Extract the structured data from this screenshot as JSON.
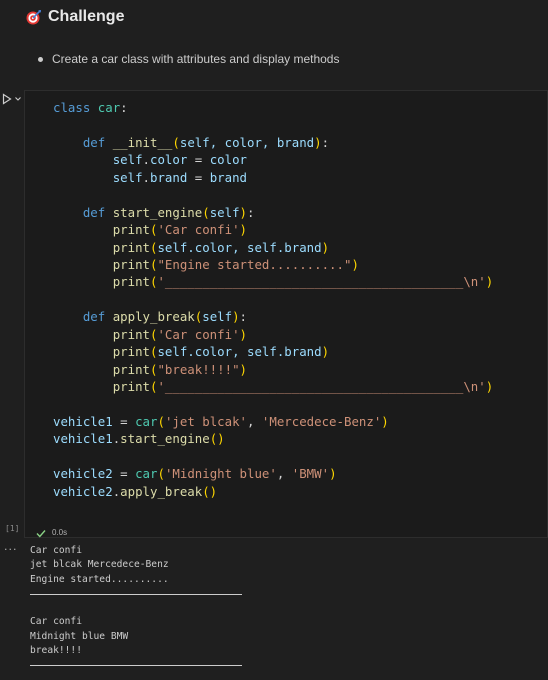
{
  "markdown": {
    "heading": "Challenge",
    "heading_icon": "dart-target-icon",
    "bullet": "Create a car class with attributes and display methods"
  },
  "cell": {
    "execution_count": "[1]",
    "status_time": "0.0s",
    "status_icon": "check-icon",
    "run_icon": "play-icon"
  },
  "code": {
    "l1_kw": "class",
    "l1_name": "car",
    "l3_kw": "def",
    "l3_fn": "__init__",
    "l3_params": "self, color, brand",
    "l4_obj": "self",
    "l4_attr": "color",
    "l4_val": "color",
    "l5_obj": "self",
    "l5_attr": "brand",
    "l5_val": "brand",
    "l7_kw": "def",
    "l7_fn": "start_engine",
    "l7_params": "self",
    "l8_fn": "print",
    "l8_str": "'Car confi'",
    "l9_fn": "print",
    "l9_args": "self.color, self.brand",
    "l10_fn": "print",
    "l10_str": "\"Engine started..........\"",
    "l11_fn": "print",
    "l11_str": "'________________________________________\\n'",
    "l13_kw": "def",
    "l13_fn": "apply_break",
    "l13_params": "self",
    "l14_fn": "print",
    "l14_str": "'Car confi'",
    "l15_fn": "print",
    "l15_args": "self.color, self.brand",
    "l16_fn": "print",
    "l16_str": "\"break!!!!\"",
    "l17_fn": "print",
    "l17_str": "'________________________________________\\n'",
    "l19_var": "vehicle1",
    "l19_cls": "car",
    "l19_a1": "'jet blcak'",
    "l19_a2": "'Mercedece-Benz'",
    "l20_var": "vehicle1",
    "l20_method": "start_engine",
    "l22_var": "vehicle2",
    "l22_cls": "car",
    "l22_a1": "'Midnight blue'",
    "l22_a2": "'BMW'",
    "l23_var": "vehicle2",
    "l23_method": "apply_break"
  },
  "output": {
    "menu": "...",
    "lines": [
      "Car confi",
      "jet blcak Mercedece-Benz",
      "Engine started..........",
      "",
      "",
      "Car confi",
      "Midnight blue BMW",
      "break!!!!",
      ""
    ]
  },
  "colors": {
    "background": "#1f1f1f",
    "keyword": "#569cd6",
    "function": "#dcdcaa",
    "class": "#4ec9b0",
    "string": "#ce9178",
    "success": "#89d185"
  }
}
